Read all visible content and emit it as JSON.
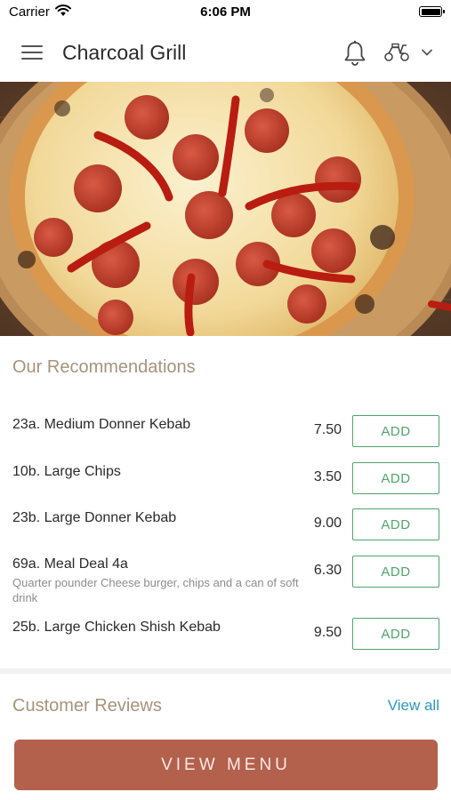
{
  "status_bar": {
    "carrier": "Carrier",
    "time": "6:06 PM"
  },
  "header": {
    "title": "Charcoal Grill",
    "icons": [
      "hamburger-menu-icon",
      "bell-icon",
      "delivery-scooter-icon",
      "chevron-down-icon"
    ]
  },
  "hero": {
    "image": "pepperoni-pizza-with-chili-peppers"
  },
  "recommendations": {
    "title": "Our Recommendations",
    "items": [
      {
        "name": "23a. Medium Donner Kebab",
        "description": "",
        "price": "7.50",
        "button": "ADD"
      },
      {
        "name": "10b. Large Chips",
        "description": "",
        "price": "3.50",
        "button": "ADD"
      },
      {
        "name": "23b. Large Donner Kebab",
        "description": "",
        "price": "9.00",
        "button": "ADD"
      },
      {
        "name": "69a. Meal Deal 4a",
        "description": "Quarter pounder Cheese burger, chips and a can of soft drink",
        "price": "6.30",
        "button": "ADD"
      },
      {
        "name": "25b. Large Chicken Shish Kebab",
        "description": "",
        "price": "9.50",
        "button": "ADD"
      }
    ]
  },
  "reviews": {
    "title": "Customer Reviews",
    "view_all": "View all"
  },
  "footer": {
    "button": "VIEW MENU"
  },
  "colors": {
    "accent_green": "#4fa56a",
    "section_title": "#a6937a",
    "link_blue": "#2a98c0",
    "primary_button": "#b3604c"
  }
}
